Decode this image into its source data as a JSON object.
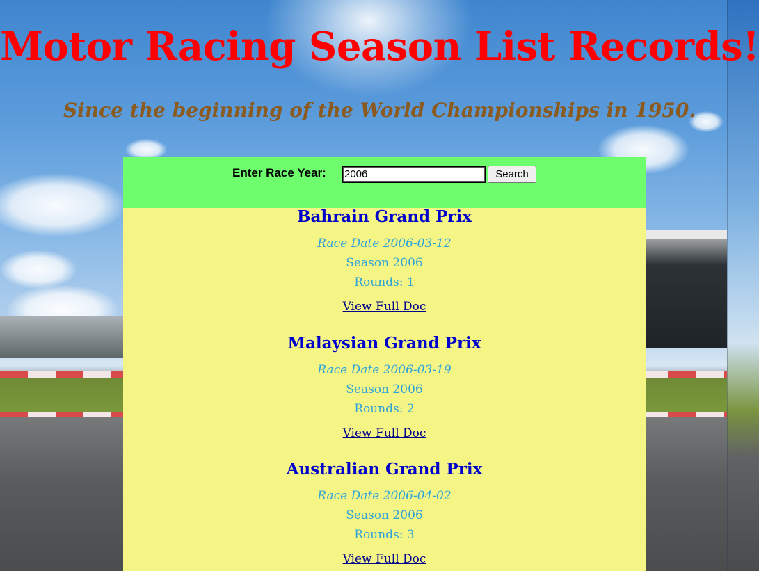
{
  "header": {
    "title": "Motor Racing Season List Records!",
    "subtitle": "Since the beginning of the World Championships in 1950."
  },
  "search": {
    "label": "Enter Race Year:",
    "value": "2006",
    "button_label": "Search"
  },
  "races": [
    {
      "name": "Bahrain Grand Prix",
      "date": "Race Date 2006-03-12",
      "season": "Season 2006",
      "rounds": "Rounds: 1",
      "link": "View Full Doc"
    },
    {
      "name": "Malaysian Grand Prix",
      "date": "Race Date 2006-03-19",
      "season": "Season 2006",
      "rounds": "Rounds: 2",
      "link": "View Full Doc"
    },
    {
      "name": "Australian Grand Prix",
      "date": "Race Date 2006-04-02",
      "season": "Season 2006",
      "rounds": "Rounds: 3",
      "link": "View Full Doc"
    }
  ],
  "colors": {
    "title": "#ff0000",
    "subtitle": "#8b5a1f",
    "search_bar": "#6dfd6d",
    "results_panel": "#f5f585",
    "race_name": "#0000cc",
    "race_details": "#2ea3d9",
    "link": "#00008b"
  }
}
